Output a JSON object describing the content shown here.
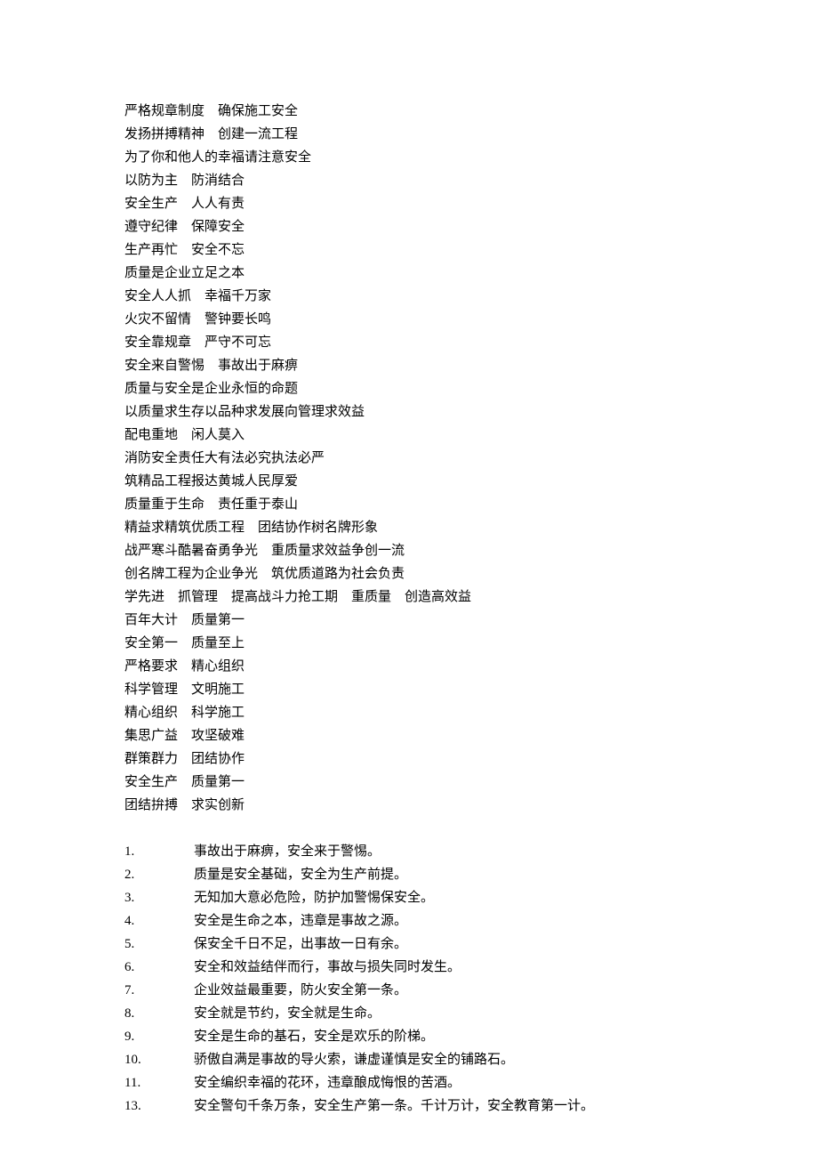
{
  "slogans": [
    "严格规章制度　确保施工安全",
    "发扬拼搏精神　创建一流工程",
    "为了你和他人的幸福请注意安全",
    "以防为主　防消结合",
    "安全生产　人人有责",
    "遵守纪律　保障安全",
    "生产再忙　安全不忘",
    "质量是企业立足之本",
    "安全人人抓　幸福千万家",
    "火灾不留情　警钟要长鸣",
    "安全靠规章　严守不可忘",
    "安全来自警惕　事故出于麻痹",
    "质量与安全是企业永恒的命题",
    "以质量求生存以品种求发展向管理求效益",
    "配电重地　闲人莫入",
    "消防安全责任大有法必究执法必严",
    "筑精品工程报达黄城人民厚爱",
    "质量重于生命　责任重于泰山",
    "精益求精筑优质工程　团结协作树名牌形象",
    "战严寒斗酷暑奋勇争光　重质量求效益争创一流",
    "创名牌工程为企业争光　筑优质道路为社会负责",
    "学先进　抓管理　提高战斗力抢工期　重质量　创造高效益",
    "百年大计　质量第一",
    "安全第一　质量至上",
    "严格要求　精心组织",
    "科学管理　文明施工",
    "精心组织　科学施工",
    "集思广益　攻坚破难",
    "群策群力　团结协作",
    "安全生产　质量第一",
    "团结拚搏　求实创新"
  ],
  "numbered": [
    {
      "num": "1.",
      "text": "事故出于麻痹，安全来于警惕。"
    },
    {
      "num": "2.",
      "text": "质量是安全基础，安全为生产前提。"
    },
    {
      "num": "3.",
      "text": "无知加大意必危险，防护加警惕保安全。"
    },
    {
      "num": "4.",
      "text": "安全是生命之本，违章是事故之源。"
    },
    {
      "num": "5.",
      "text": "保安全千日不足，出事故一日有余。"
    },
    {
      "num": "6.",
      "text": "安全和效益结伴而行，事故与损失同时发生。"
    },
    {
      "num": "7.",
      "text": "企业效益最重要，防火安全第一条。"
    },
    {
      "num": "8.",
      "text": "安全就是节约，安全就是生命。"
    },
    {
      "num": "9.",
      "text": "安全是生命的基石，安全是欢乐的阶梯。"
    },
    {
      "num": "10.",
      "text": "骄傲自满是事故的导火索，谦虚谨慎是安全的铺路石。"
    },
    {
      "num": "11.",
      "text": "安全编织幸福的花环，违章酿成悔恨的苦酒。"
    },
    {
      "num": "13.",
      "text": "安全警句千条万条，安全生产第一条。千计万计，安全教育第一计。"
    }
  ]
}
